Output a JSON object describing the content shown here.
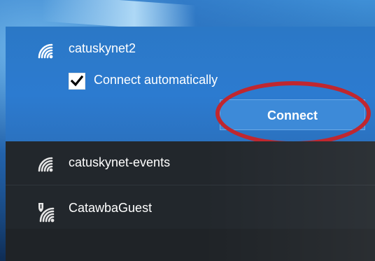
{
  "colors": {
    "selected_bg": "#2C7BD0",
    "list_bg": "#22272C",
    "connect_bg": "#3D8AD8",
    "highlight": "#C0272F",
    "text": "#FFFFFF"
  },
  "selected_network": {
    "ssid": "catuskynet2",
    "icon": "wifi-signal-icon",
    "connect_automatically": {
      "label": "Connect automatically",
      "checked": true
    },
    "connect_button_label": "Connect"
  },
  "other_networks": [
    {
      "ssid": "catuskynet-events",
      "icon": "wifi-signal-icon",
      "secured_shield": false
    },
    {
      "ssid": "CatawbaGuest",
      "icon": "wifi-shield-icon",
      "secured_shield": true
    }
  ]
}
